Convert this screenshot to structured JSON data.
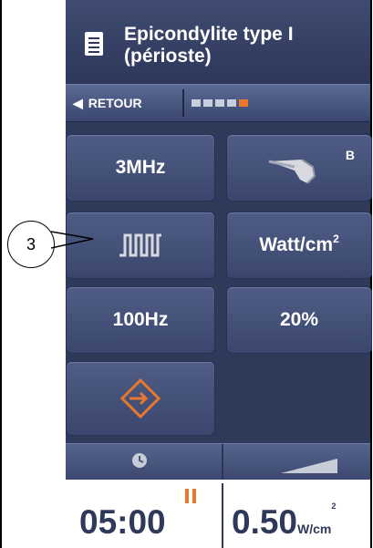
{
  "header": {
    "title_line1": "Epicondylite type I",
    "title_line2": "(périoste)",
    "icon": "document-icon"
  },
  "nav": {
    "back_label": "RETOUR",
    "progress_total": 5,
    "progress_active_index": 4
  },
  "buttons": {
    "frequency": "3MHz",
    "probe_label": "B",
    "wave": "pulsed-waveform-icon",
    "unit_base": "Watt/cm",
    "unit_exp": "2",
    "rate": "100Hz",
    "duty": "20%",
    "enter": "enter-icon"
  },
  "footer": {
    "timer": "05:00",
    "power_value": "0.50",
    "power_unit_base": "W/cm",
    "power_unit_exp": "2"
  },
  "callout": {
    "label": "3"
  },
  "colors": {
    "panel": "#2f3a5b",
    "accent": "#e9782c",
    "text": "#ffffff"
  }
}
